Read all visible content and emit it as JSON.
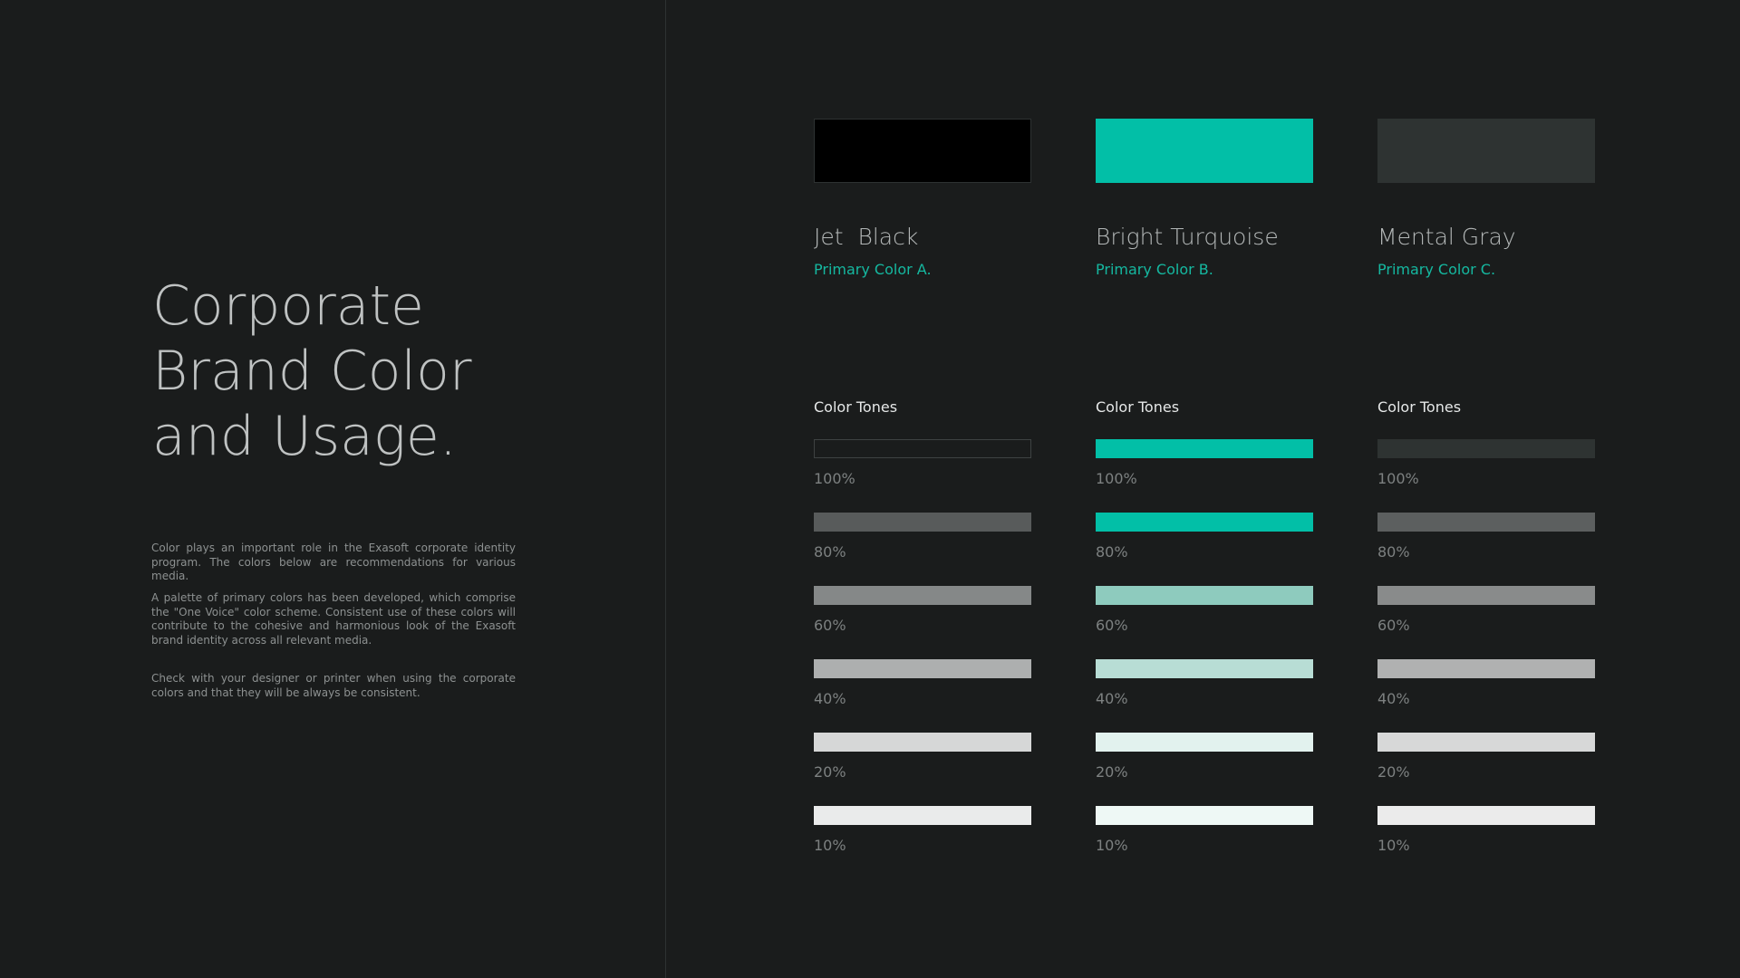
{
  "title": {
    "line1": "Corporate",
    "line2": "Brand Color",
    "line3": "and Usage."
  },
  "paragraphs": [
    "Color plays an important role in the Exasoft corporate identity program. The colors below are recommendations for various media.",
    "A palette of primary colors has been developed, which comprise the \"One Voice\" color scheme. Consistent use of these colors will contribute to the cohesive and harmonious look of the Exasoft brand identity across all relevant media.",
    "Check with your designer or printer when using the corporate colors and that they will be always be consistent."
  ],
  "colors": [
    {
      "name": "Jet  Black",
      "subtitle": "Primary Color A.",
      "hex": "#000000",
      "tones_label": "Color Tones",
      "tones": [
        {
          "label": "100%",
          "hex": "#1a1c1c"
        },
        {
          "label": "80%",
          "hex": "#585b5b"
        },
        {
          "label": "60%",
          "hex": "#858888"
        },
        {
          "label": "40%",
          "hex": "#adafaf"
        },
        {
          "label": "20%",
          "hex": "#d6d7d7"
        },
        {
          "label": "10%",
          "hex": "#eaebeb"
        }
      ]
    },
    {
      "name": "Bright Turquoise",
      "subtitle": "Primary Color B.",
      "hex": "#02bfa7",
      "tones_label": "Color Tones",
      "tones": [
        {
          "label": "100%",
          "hex": "#02bfa7"
        },
        {
          "label": "80%",
          "hex": "#02bfa7"
        },
        {
          "label": "60%",
          "hex": "#8ecbbe"
        },
        {
          "label": "40%",
          "hex": "#b8ddd5"
        },
        {
          "label": "20%",
          "hex": "#e2f2ee"
        },
        {
          "label": "10%",
          "hex": "#eef8f5"
        }
      ]
    },
    {
      "name": "Mental Gray",
      "subtitle": "Primary Color C.",
      "hex": "#2e3332",
      "tones_label": "Color Tones",
      "tones": [
        {
          "label": "100%",
          "hex": "#2e3332"
        },
        {
          "label": "80%",
          "hex": "#5c5f5f"
        },
        {
          "label": "60%",
          "hex": "#898b8b"
        },
        {
          "label": "40%",
          "hex": "#b0b1b1"
        },
        {
          "label": "20%",
          "hex": "#d7d8d8"
        },
        {
          "label": "10%",
          "hex": "#ebebeb"
        }
      ]
    }
  ]
}
